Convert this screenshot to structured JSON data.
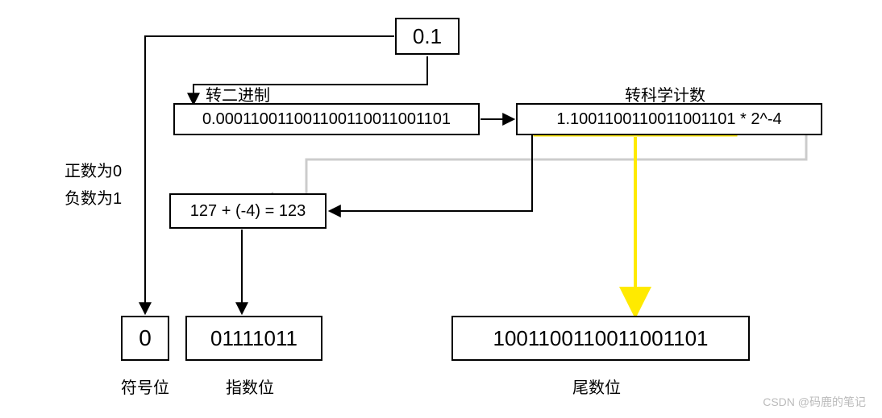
{
  "title_box": "0.1",
  "binary_label": "转二进制",
  "binary_box": "0.000110011001100110011001101",
  "scientific_label": "转科学计数",
  "scientific_box": "1.1001100110011001101 * 2^-4",
  "positive_label": "正数为0",
  "negative_label": "负数为1",
  "exponent_formula": "127 + (-4) = 123",
  "sign_bit_value": "0",
  "exponent_bits_value": "01111011",
  "mantissa_bits_value": "1001100110011001101",
  "sign_bit_label": "符号位",
  "exponent_bits_label": "指数位",
  "mantissa_bits_label": "尾数位",
  "watermark": "CSDN @码鹿的笔记"
}
